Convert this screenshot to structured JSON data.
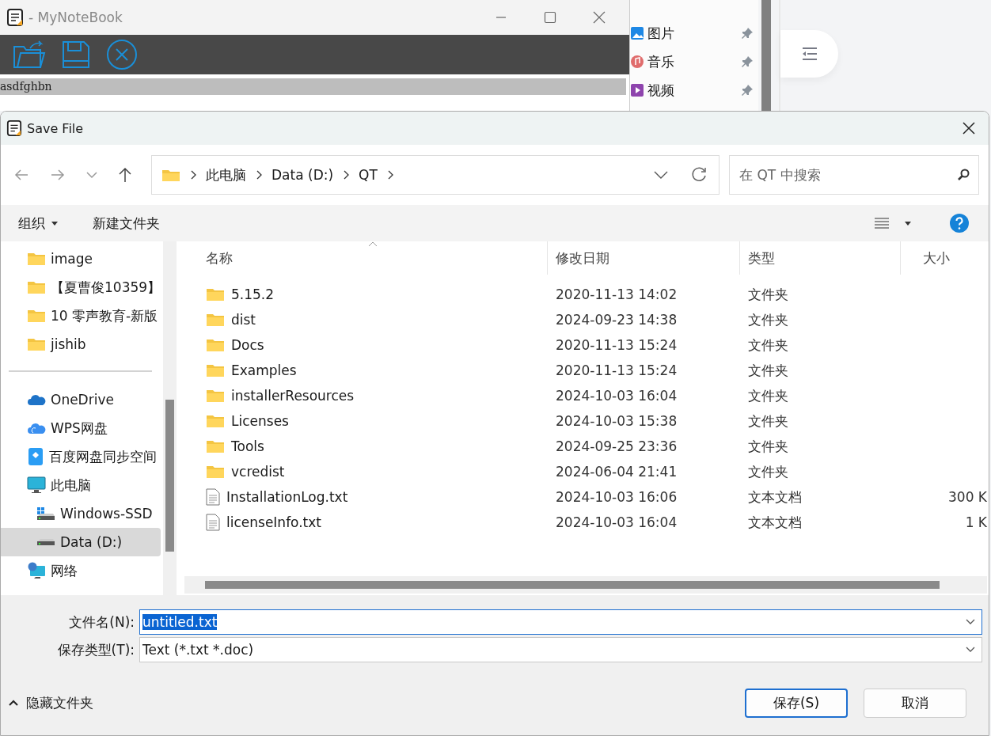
{
  "notebook": {
    "title": "- MyNoteBook",
    "text": "asdfghbn"
  },
  "quick_access": [
    {
      "label": "图片",
      "kind": "pictures"
    },
    {
      "label": "音乐",
      "kind": "music"
    },
    {
      "label": "视频",
      "kind": "video"
    }
  ],
  "dialog": {
    "title": "Save File",
    "breadcrumbs": [
      "此电脑",
      "Data (D:)",
      "QT"
    ],
    "search": {
      "placeholder": "在 QT 中搜索"
    },
    "toolbar": {
      "organize": "组织",
      "new_folder": "新建文件夹"
    },
    "nav": [
      {
        "label": "image",
        "kind": "folder",
        "selected": false
      },
      {
        "label": "【夏曹俊10359】",
        "kind": "folder",
        "selected": false
      },
      {
        "label": "10 零声教育-新版",
        "kind": "folder",
        "selected": false
      },
      {
        "label": "jishib",
        "kind": "folder",
        "selected": false
      },
      {
        "kind": "divider"
      },
      {
        "label": "OneDrive",
        "kind": "onedrive",
        "selected": false
      },
      {
        "label": "WPS网盘",
        "kind": "cloud",
        "selected": false
      },
      {
        "label": "百度网盘同步空间",
        "kind": "sync",
        "selected": false
      },
      {
        "label": "此电脑",
        "kind": "pc",
        "selected": false,
        "children": [
          {
            "label": "Windows-SSD",
            "kind": "windrive",
            "selected": false
          },
          {
            "label": "Data (D:)",
            "kind": "drive",
            "selected": true
          }
        ]
      },
      {
        "label": "网络",
        "kind": "network",
        "selected": false
      }
    ],
    "columns": [
      "名称",
      "修改日期",
      "类型",
      "大小"
    ],
    "files": [
      {
        "name": "5.15.2",
        "kind": "folder",
        "date": "2020-11-13 14:02",
        "type": "文件夹",
        "selected": false
      },
      {
        "name": "dist",
        "kind": "folder",
        "date": "2024-09-23 14:38",
        "type": "文件夹",
        "selected": false
      },
      {
        "name": "Docs",
        "kind": "folder",
        "date": "2020-11-13 15:24",
        "type": "文件夹",
        "selected": false
      },
      {
        "name": "Examples",
        "kind": "folder",
        "date": "2020-11-13 15:24",
        "type": "文件夹",
        "selected": false
      },
      {
        "name": "installerResources",
        "kind": "folder",
        "date": "2024-10-03 16:04",
        "type": "文件夹",
        "selected": false
      },
      {
        "name": "Licenses",
        "kind": "folder",
        "date": "2024-10-03 15:38",
        "type": "文件夹",
        "selected": false
      },
      {
        "name": "Tools",
        "kind": "folder",
        "date": "2024-09-25 23:36",
        "type": "文件夹",
        "selected": false
      },
      {
        "name": "vcredist",
        "kind": "folder",
        "date": "2024-06-04 21:41",
        "type": "文件夹",
        "selected": false
      },
      {
        "name": "InstallationLog.txt",
        "kind": "file",
        "date": "2024-10-03 16:06",
        "type": "文本文档",
        "size": "300 K",
        "selected": false
      },
      {
        "name": "licenseInfo.txt",
        "kind": "file",
        "date": "2024-10-03 16:04",
        "type": "文本文档",
        "size": "1 K",
        "selected": false
      }
    ],
    "filename": {
      "label": "文件名(N):",
      "value": "untitled.txt"
    },
    "filetype": {
      "label": "保存类型(T):",
      "value": "Text (*.txt *.doc)"
    },
    "hide_folders": "隐藏文件夹",
    "buttons": [
      {
        "label": "保存(S)",
        "kind": "primary"
      },
      {
        "label": "取消",
        "kind": "normal"
      }
    ]
  }
}
